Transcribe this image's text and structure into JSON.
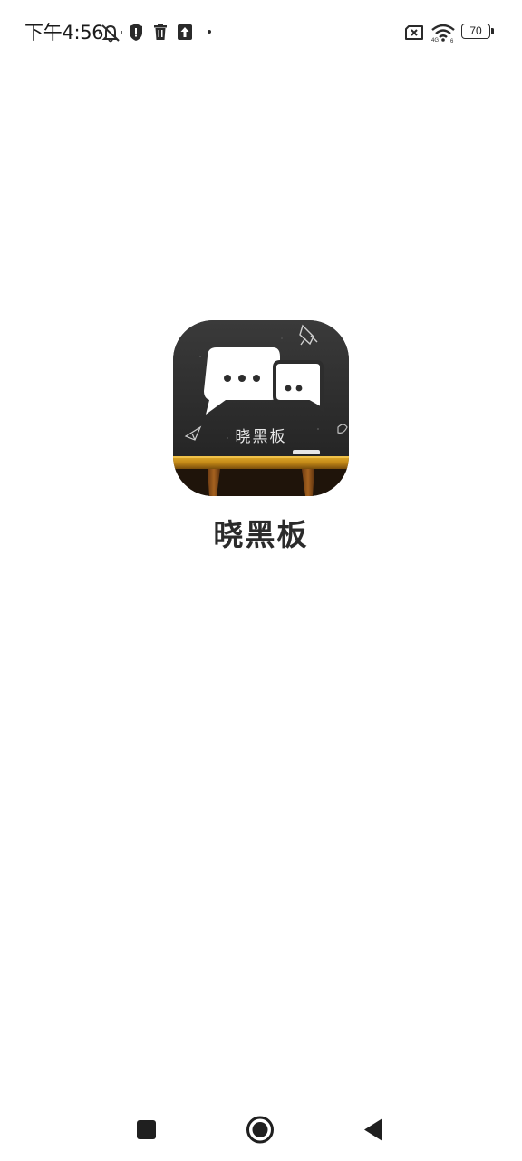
{
  "status_bar": {
    "time": "下午4:56",
    "battery_level": "70",
    "icons": [
      "notifications-muted-icon",
      "shield-icon",
      "trash-icon",
      "upload-icon",
      "dot-icon",
      "no-sim-icon",
      "wifi-icon",
      "battery-icon"
    ]
  },
  "splash": {
    "app_name": "晓黑板",
    "logo_text": "晓黑板"
  },
  "nav_bar": {
    "buttons": [
      "recents",
      "home",
      "back"
    ]
  },
  "colors": {
    "background": "#ffffff",
    "chalkboard": "#2d2d2d",
    "chalk_tray": "#c8901c",
    "text_primary": "#2b2b2b"
  }
}
